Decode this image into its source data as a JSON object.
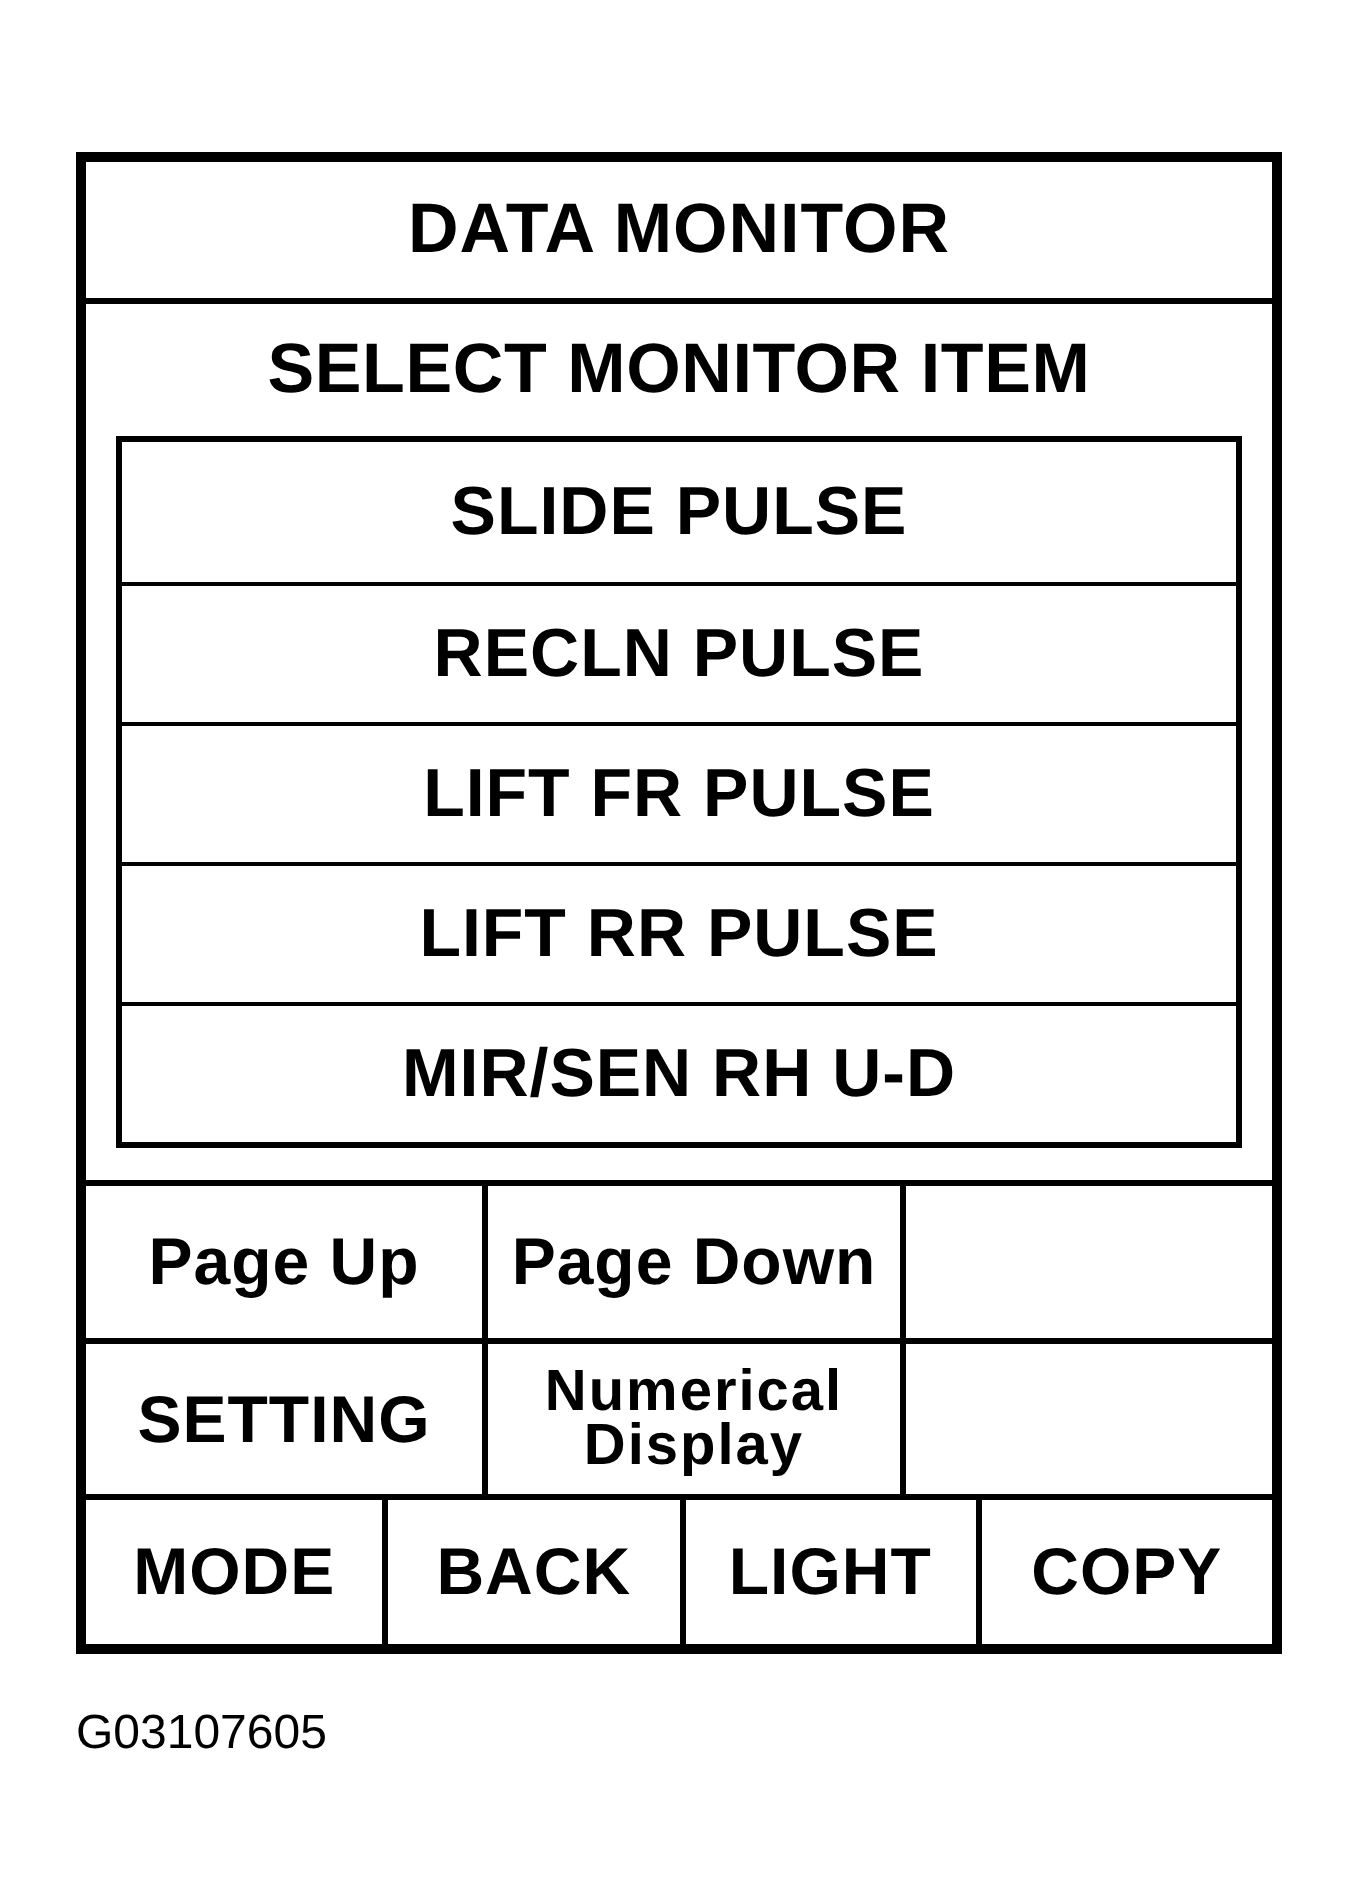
{
  "title": "DATA MONITOR",
  "prompt": "SELECT MONITOR ITEM",
  "monitor_items": [
    "SLIDE PULSE",
    "RECLN PULSE",
    "LIFT FR PULSE",
    "LIFT RR PULSE",
    "MIR/SEN RH U-D"
  ],
  "function_keys": [
    [
      "Page Up",
      "Page Down"
    ],
    [
      "SETTING",
      "Numerical Display"
    ]
  ],
  "bottom_keys": [
    "MODE",
    "BACK",
    "LIGHT",
    "COPY"
  ],
  "figure_code": "G03107605"
}
